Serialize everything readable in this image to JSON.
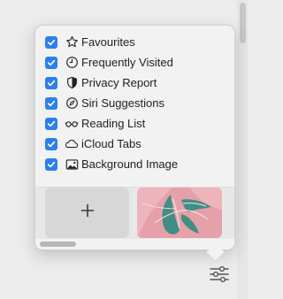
{
  "customize_menu": {
    "items": [
      {
        "label": "Favourites",
        "checked": true,
        "icon": "star-icon"
      },
      {
        "label": "Frequently Visited",
        "checked": true,
        "icon": "clock-icon"
      },
      {
        "label": "Privacy Report",
        "checked": true,
        "icon": "shield-icon"
      },
      {
        "label": "Siri Suggestions",
        "checked": true,
        "icon": "compass-icon"
      },
      {
        "label": "Reading List",
        "checked": true,
        "icon": "glasses-icon"
      },
      {
        "label": "iCloud Tabs",
        "checked": true,
        "icon": "cloud-icon"
      },
      {
        "label": "Background Image",
        "checked": true,
        "icon": "photo-icon"
      }
    ],
    "background_tiles": {
      "add_tile_icon": "plus-icon",
      "image_tile_colors": [
        "#e8a0aa",
        "#3f8f84",
        "#f3d6dc"
      ]
    }
  },
  "toolbar": {
    "settings_icon": "sliders-icon"
  },
  "colors": {
    "accent": "#2b7ff5",
    "popover_bg": "#f2f2f2",
    "page_bg": "#ececec"
  }
}
